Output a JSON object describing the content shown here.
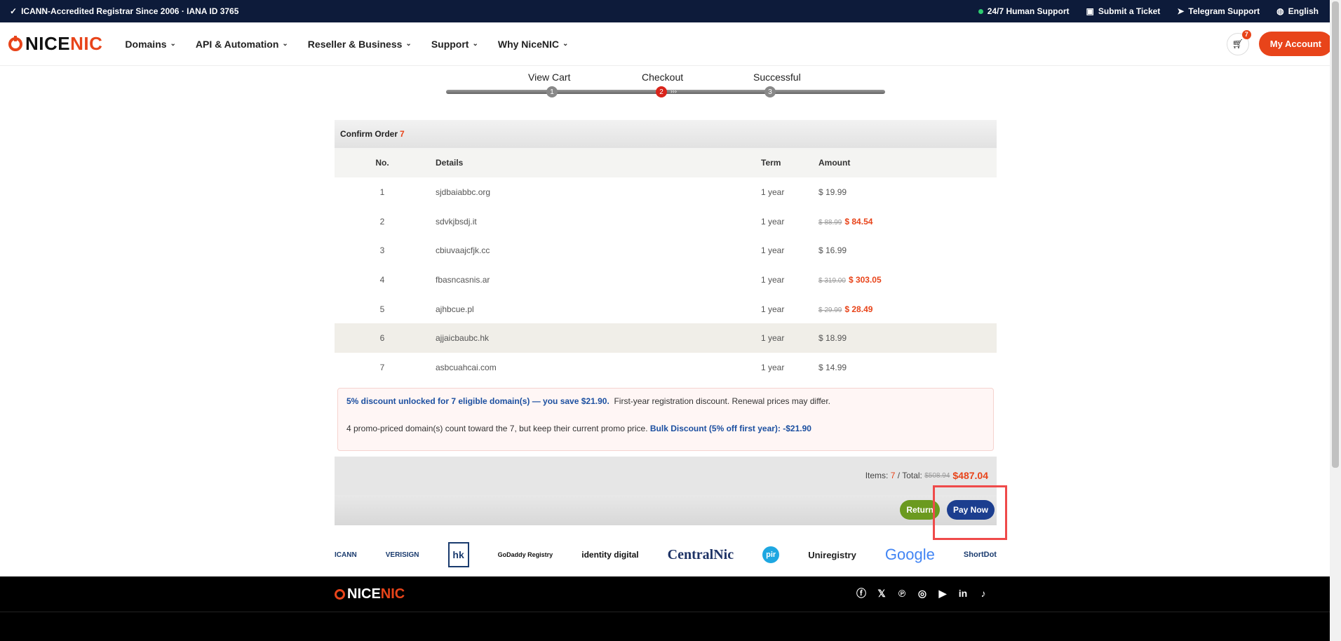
{
  "topbar": {
    "accreditation": "ICANN-Accredited Registrar Since 2006 · IANA ID 3765",
    "support": "24/7 Human Support",
    "ticket": "Submit a Ticket",
    "telegram": "Telegram Support",
    "language": "English"
  },
  "header": {
    "logo_nice": "NICE",
    "logo_nic": "NIC",
    "nav": [
      "Domains",
      "API & Automation",
      "Reseller & Business",
      "Support",
      "Why NiceNIC"
    ],
    "cart_count": "7",
    "my_account": "My Account"
  },
  "steps": {
    "labels": [
      "View Cart",
      "Checkout",
      "Successful"
    ],
    "numbers": [
      "1",
      "2",
      "3"
    ],
    "active": 2
  },
  "order": {
    "title": "Confirm Order",
    "count": "7",
    "columns": [
      "No.",
      "Details",
      "Term",
      "Amount"
    ],
    "rows": [
      {
        "no": "1",
        "domain": "sjdbaiabbc.org",
        "term": "1 year",
        "old": "",
        "amount": "$ 19.99"
      },
      {
        "no": "2",
        "domain": "sdvkjbsdj.it",
        "term": "1 year",
        "old": "$ 88.99",
        "amount": "$ 84.54"
      },
      {
        "no": "3",
        "domain": "cbiuvaajcfjk.cc",
        "term": "1 year",
        "old": "",
        "amount": "$ 16.99"
      },
      {
        "no": "4",
        "domain": "fbasncasnis.ar",
        "term": "1 year",
        "old": "$ 319.00",
        "amount": "$ 303.05"
      },
      {
        "no": "5",
        "domain": "ajhbcue.pl",
        "term": "1 year",
        "old": "$ 29.99",
        "amount": "$ 28.49"
      },
      {
        "no": "6",
        "domain": "ajjaicbaubc.hk",
        "term": "1 year",
        "old": "",
        "amount": "$ 18.99"
      },
      {
        "no": "7",
        "domain": "asbcuahcai.com",
        "term": "1 year",
        "old": "",
        "amount": "$ 14.99"
      }
    ],
    "discount_line1_strong": "5% discount unlocked for 7 eligible domain(s) — you save $21.90.",
    "discount_line1_rest": "First-year registration discount. Renewal prices may differ.",
    "discount_line2_text": "4 promo-priced domain(s) count toward the 7, but keep their current promo price.",
    "discount_line2_strong": "Bulk Discount (5% off first year): -$21.90",
    "items_label": "Items:",
    "items_count": "7",
    "total_label": "/ Total:",
    "total_old": "$508.94",
    "total_new": "$487.04",
    "return_label": "Return",
    "pay_label": "Pay Now"
  },
  "partners": [
    "ICANN",
    "VERISIGN",
    "hk",
    "GoDaddy Registry",
    "identity digital",
    "CentralNic",
    "pir",
    "Uniregistry",
    "Google",
    "ShortDot"
  ],
  "footer": {
    "logo_nice": "NICE",
    "logo_nic": "NIC",
    "social_icons": [
      "facebook-icon",
      "x-icon",
      "pinterest-icon",
      "instagram-icon",
      "youtube-icon",
      "linkedin-icon",
      "tiktok-icon"
    ]
  },
  "colors": {
    "brand": "#e8441a",
    "topbar": "#0d1b3a",
    "pay_button": "#1c3e8f",
    "return_button": "#6b9a1f"
  }
}
